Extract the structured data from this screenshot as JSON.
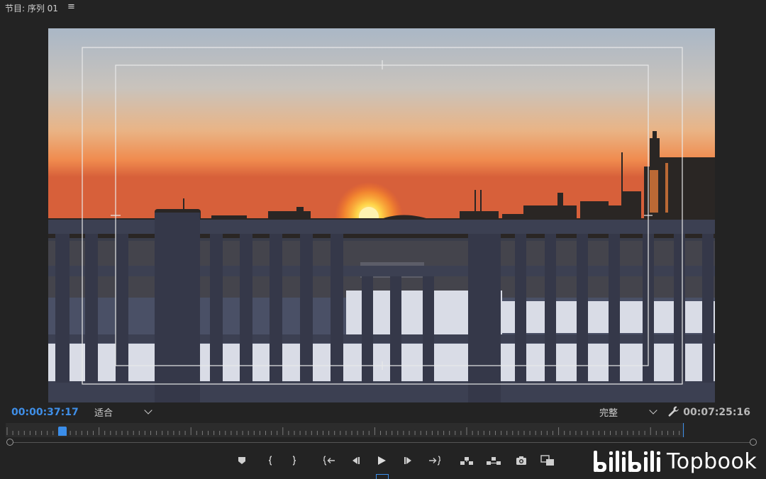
{
  "panel": {
    "title": "节目: 序列 01",
    "menu_icon": "hamburger-menu-icon"
  },
  "timecode": {
    "current": "00:00:37:17",
    "duration": "00:07:25:16"
  },
  "zoom": {
    "selected": "适合"
  },
  "quality": {
    "selected": "完整"
  },
  "playhead_position_fraction": 0.084,
  "colors": {
    "accent": "#3b8eea",
    "panel_bg": "#232323",
    "frame_guides": "#e8e8e8"
  },
  "transport_icons": [
    "add-marker-icon",
    "mark-in-icon",
    "mark-out-icon",
    "go-to-in-icon",
    "step-back-icon",
    "play-icon",
    "step-forward-icon",
    "go-to-out-icon",
    "lift-icon",
    "extract-icon",
    "export-frame-icon",
    "comparison-view-icon"
  ],
  "watermark": {
    "logo": "bilibili-logo",
    "text": "Topbook"
  }
}
